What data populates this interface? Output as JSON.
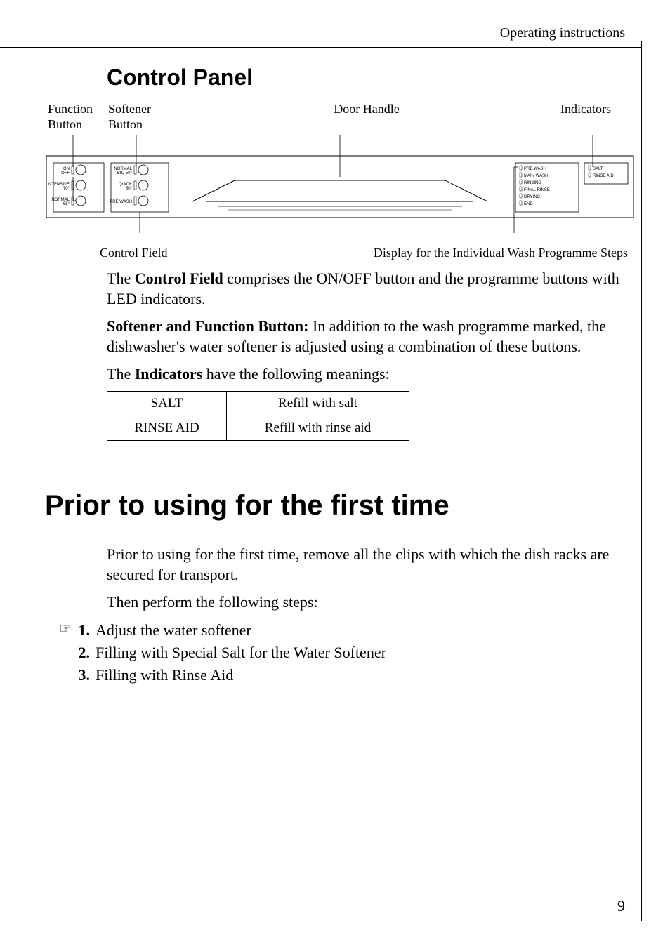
{
  "header": {
    "running": "Operating instructions"
  },
  "section": {
    "title": "Control Panel"
  },
  "diagram": {
    "labels_top": {
      "function": "Function Button",
      "softener": "Softener Button",
      "door": "Door Handle",
      "indicators": "Indicators"
    },
    "labels_bottom": {
      "control_field": "Control Field",
      "display": "Display for the Individual Wash Programme Steps"
    },
    "panel": {
      "on_off": "ON OFF",
      "intensive": "INTENSIVE 70°",
      "normal65": "NORMAL 65°",
      "normalbio": "NORMAL BIO 50°",
      "quick": "QUICK 50°",
      "prewash_btn": "PRE WASH",
      "steps": [
        "PRE WASH",
        "MAIN WASH",
        "RINSING",
        "FINAL RINSE",
        "DRYING",
        "END"
      ],
      "indicators": [
        "SALT",
        "RINSE AID"
      ]
    }
  },
  "paragraphs": {
    "p1_a": "The ",
    "p1_b": "Control Field",
    "p1_c": " comprises the ON/OFF button and the programme buttons with LED indicators.",
    "p2_a": "Softener and Function Button:",
    "p2_b": " In addition to the wash programme marked, the dishwasher's water softener is adjusted using a combination of these buttons.",
    "p3_a": "The ",
    "p3_b": "Indicators",
    "p3_c": " have the following meanings:"
  },
  "table": {
    "rows": [
      {
        "label": "SALT",
        "meaning": "Refill with salt"
      },
      {
        "label": "RINSE AID",
        "meaning": "Refill with rinse aid"
      }
    ]
  },
  "main": {
    "title": "Prior to using for the first time",
    "intro1": "Prior to using for the first time, remove all the clips with which the dish racks are secured for transport.",
    "intro2": "Then perform the following steps:",
    "steps": [
      {
        "num": "1.",
        "text": "Adjust the water softener",
        "icon": "☞"
      },
      {
        "num": "2.",
        "text": "Filling with Special Salt for the Water Softener",
        "icon": ""
      },
      {
        "num": "3.",
        "text": "Filling with Rinse Aid",
        "icon": ""
      }
    ]
  },
  "page_number": "9"
}
